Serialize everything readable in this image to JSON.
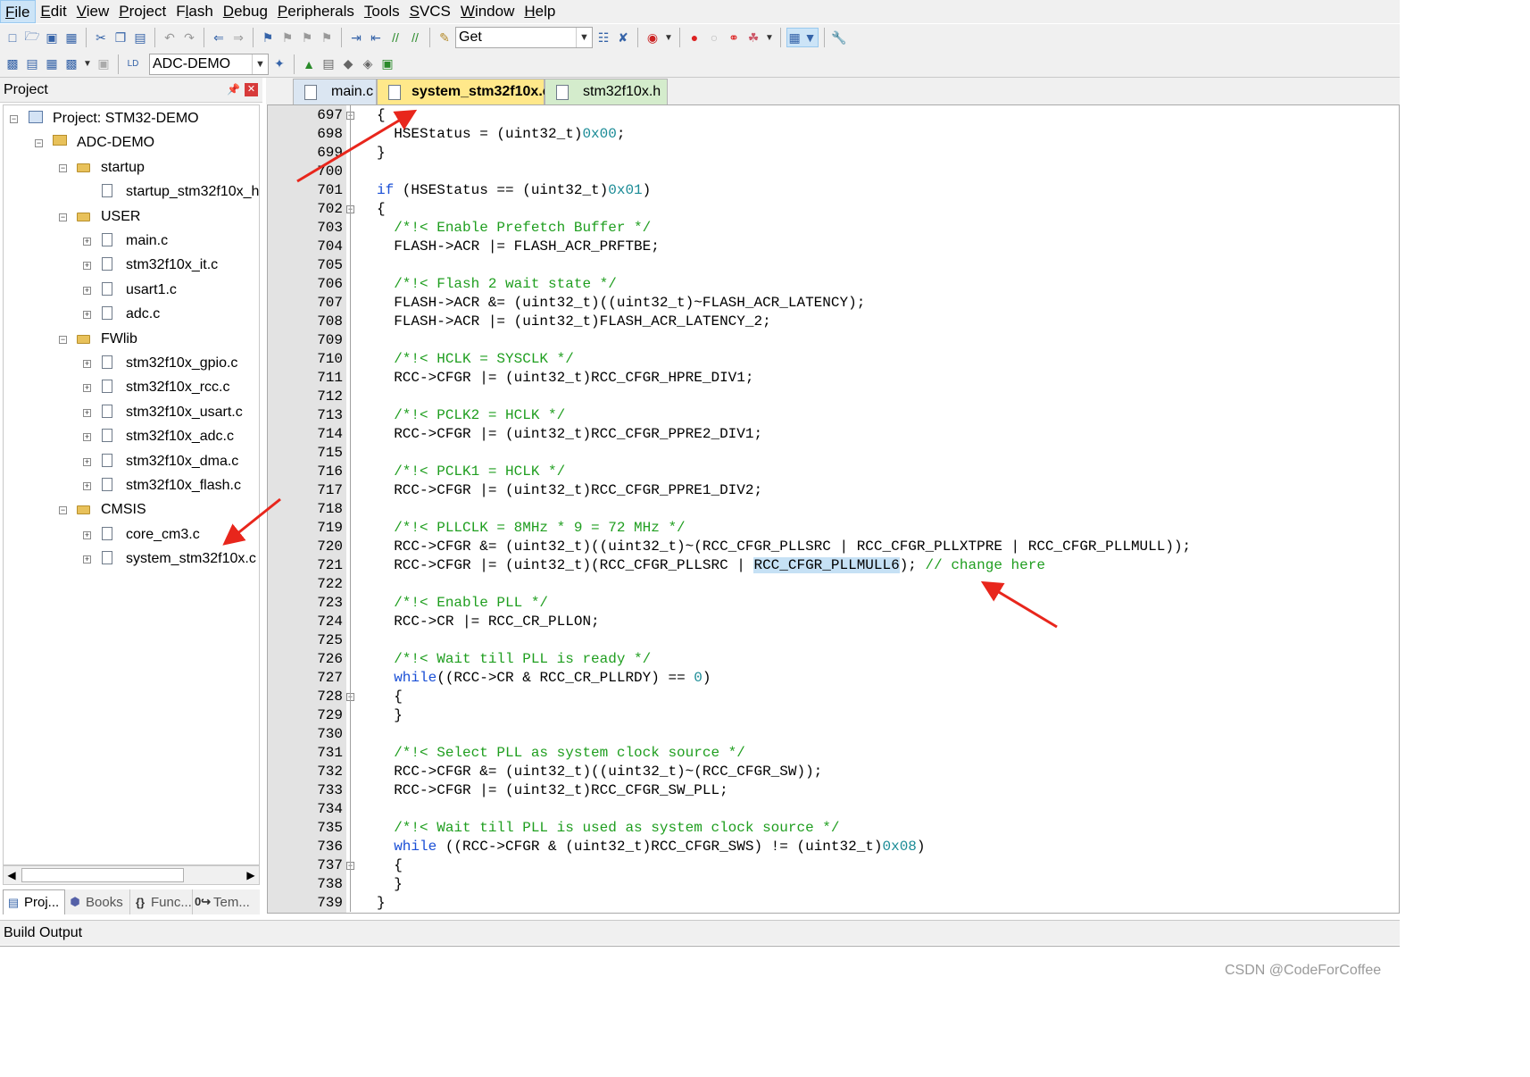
{
  "menu": [
    "File",
    "Edit",
    "View",
    "Project",
    "Flash",
    "Debug",
    "Peripherals",
    "Tools",
    "SVCS",
    "Window",
    "Help"
  ],
  "toolbar": {
    "find_value": "Get",
    "target_value": "ADC-DEMO"
  },
  "project_panel": {
    "title": "Project",
    "tree": [
      {
        "label": "Project: STM32-DEMO",
        "type": "project",
        "level": 0,
        "expander": "minus"
      },
      {
        "label": "ADC-DEMO",
        "type": "target",
        "level": 1,
        "expander": "minus"
      },
      {
        "label": "startup",
        "type": "folder",
        "level": 2,
        "expander": "minus"
      },
      {
        "label": "startup_stm32f10x_h",
        "type": "file",
        "level": 3,
        "expander": ""
      },
      {
        "label": "USER",
        "type": "folder",
        "level": 2,
        "expander": "minus"
      },
      {
        "label": "main.c",
        "type": "file",
        "level": 3,
        "expander": "plus"
      },
      {
        "label": "stm32f10x_it.c",
        "type": "file",
        "level": 3,
        "expander": "plus"
      },
      {
        "label": "usart1.c",
        "type": "file",
        "level": 3,
        "expander": "plus"
      },
      {
        "label": "adc.c",
        "type": "file",
        "level": 3,
        "expander": "plus"
      },
      {
        "label": "FWlib",
        "type": "folder",
        "level": 2,
        "expander": "minus"
      },
      {
        "label": "stm32f10x_gpio.c",
        "type": "file",
        "level": 3,
        "expander": "plus"
      },
      {
        "label": "stm32f10x_rcc.c",
        "type": "file",
        "level": 3,
        "expander": "plus"
      },
      {
        "label": "stm32f10x_usart.c",
        "type": "file",
        "level": 3,
        "expander": "plus"
      },
      {
        "label": "stm32f10x_adc.c",
        "type": "file",
        "level": 3,
        "expander": "plus"
      },
      {
        "label": "stm32f10x_dma.c",
        "type": "file",
        "level": 3,
        "expander": "plus"
      },
      {
        "label": "stm32f10x_flash.c",
        "type": "file",
        "level": 3,
        "expander": "plus"
      },
      {
        "label": "CMSIS",
        "type": "folder",
        "level": 2,
        "expander": "minus"
      },
      {
        "label": "core_cm3.c",
        "type": "file",
        "level": 3,
        "expander": "plus"
      },
      {
        "label": "system_stm32f10x.c",
        "type": "file",
        "level": 3,
        "expander": "plus"
      }
    ],
    "tabs": [
      "Proj...",
      "Books",
      "Func...",
      "Tem..."
    ]
  },
  "file_tabs": [
    {
      "label": "main.c",
      "active": false
    },
    {
      "label": "system_stm32f10x.c",
      "active": true
    },
    {
      "label": "stm32f10x.h",
      "active": false
    }
  ],
  "code": [
    {
      "n": "697",
      "fold": "minus",
      "t": [
        [
          "p",
          "{"
        ]
      ]
    },
    {
      "n": "698",
      "fold": "",
      "t": [
        [
          "p",
          "  HSEStatus = (uint32_t)"
        ],
        [
          "nm",
          "0x00"
        ],
        [
          "p",
          ";"
        ]
      ]
    },
    {
      "n": "699",
      "fold": "",
      "t": [
        [
          "p",
          "}"
        ]
      ]
    },
    {
      "n": "700",
      "fold": "",
      "t": []
    },
    {
      "n": "701",
      "fold": "",
      "t": [
        [
          "kw",
          "if"
        ],
        [
          "p",
          " (HSEStatus == (uint32_t)"
        ],
        [
          "nm",
          "0x01"
        ],
        [
          "p",
          ")"
        ]
      ]
    },
    {
      "n": "702",
      "fold": "minus",
      "t": [
        [
          "p",
          "{"
        ]
      ]
    },
    {
      "n": "703",
      "fold": "",
      "t": [
        [
          "cm",
          "  /*!< Enable Prefetch Buffer */"
        ]
      ]
    },
    {
      "n": "704",
      "fold": "",
      "t": [
        [
          "p",
          "  FLASH->ACR |= FLASH_ACR_PRFTBE;"
        ]
      ]
    },
    {
      "n": "705",
      "fold": "",
      "t": []
    },
    {
      "n": "706",
      "fold": "",
      "t": [
        [
          "cm",
          "  /*!< Flash 2 wait state */"
        ]
      ]
    },
    {
      "n": "707",
      "fold": "",
      "t": [
        [
          "p",
          "  FLASH->ACR &= (uint32_t)((uint32_t)~FLASH_ACR_LATENCY);"
        ]
      ]
    },
    {
      "n": "708",
      "fold": "",
      "t": [
        [
          "p",
          "  FLASH->ACR |= (uint32_t)FLASH_ACR_LATENCY_2;"
        ]
      ]
    },
    {
      "n": "709",
      "fold": "",
      "t": []
    },
    {
      "n": "710",
      "fold": "",
      "t": [
        [
          "cm",
          "  /*!< HCLK = SYSCLK */"
        ]
      ]
    },
    {
      "n": "711",
      "fold": "",
      "t": [
        [
          "p",
          "  RCC->CFGR |= (uint32_t)RCC_CFGR_HPRE_DIV1;"
        ]
      ]
    },
    {
      "n": "712",
      "fold": "",
      "t": []
    },
    {
      "n": "713",
      "fold": "",
      "t": [
        [
          "cm",
          "  /*!< PCLK2 = HCLK */"
        ]
      ]
    },
    {
      "n": "714",
      "fold": "",
      "t": [
        [
          "p",
          "  RCC->CFGR |= (uint32_t)RCC_CFGR_PPRE2_DIV1;"
        ]
      ]
    },
    {
      "n": "715",
      "fold": "",
      "t": []
    },
    {
      "n": "716",
      "fold": "",
      "t": [
        [
          "cm",
          "  /*!< PCLK1 = HCLK */"
        ]
      ]
    },
    {
      "n": "717",
      "fold": "",
      "t": [
        [
          "p",
          "  RCC->CFGR |= (uint32_t)RCC_CFGR_PPRE1_DIV2;"
        ]
      ]
    },
    {
      "n": "718",
      "fold": "",
      "t": []
    },
    {
      "n": "719",
      "fold": "",
      "t": [
        [
          "cm",
          "  /*!< PLLCLK = 8MHz * 9 = 72 MHz */"
        ]
      ]
    },
    {
      "n": "720",
      "fold": "",
      "t": [
        [
          "p",
          "  RCC->CFGR &= (uint32_t)((uint32_t)~(RCC_CFGR_PLLSRC | RCC_CFGR_PLLXTPRE | RCC_CFGR_PLLMULL));"
        ]
      ]
    },
    {
      "n": "721",
      "fold": "",
      "t": [
        [
          "p",
          "  RCC->CFGR |= (uint32_t)(RCC_CFGR_PLLSRC | "
        ],
        [
          "hl",
          "RCC_CFGR_PLLMULL6"
        ],
        [
          "p",
          "); "
        ],
        [
          "cm",
          "// change here"
        ]
      ]
    },
    {
      "n": "722",
      "fold": "",
      "t": []
    },
    {
      "n": "723",
      "fold": "",
      "t": [
        [
          "cm",
          "  /*!< Enable PLL */"
        ]
      ]
    },
    {
      "n": "724",
      "fold": "",
      "t": [
        [
          "p",
          "  RCC->CR |= RCC_CR_PLLON;"
        ]
      ]
    },
    {
      "n": "725",
      "fold": "",
      "t": []
    },
    {
      "n": "726",
      "fold": "",
      "t": [
        [
          "cm",
          "  /*!< Wait till PLL is ready */"
        ]
      ]
    },
    {
      "n": "727",
      "fold": "",
      "t": [
        [
          "kw",
          "  while"
        ],
        [
          "p",
          "((RCC->CR & RCC_CR_PLLRDY) == "
        ],
        [
          "nm",
          "0"
        ],
        [
          "p",
          ")"
        ]
      ]
    },
    {
      "n": "728",
      "fold": "minus",
      "t": [
        [
          "p",
          "  {"
        ]
      ]
    },
    {
      "n": "729",
      "fold": "",
      "t": [
        [
          "p",
          "  }"
        ]
      ]
    },
    {
      "n": "730",
      "fold": "",
      "t": []
    },
    {
      "n": "731",
      "fold": "",
      "t": [
        [
          "cm",
          "  /*!< Select PLL as system clock source */"
        ]
      ]
    },
    {
      "n": "732",
      "fold": "",
      "t": [
        [
          "p",
          "  RCC->CFGR &= (uint32_t)((uint32_t)~(RCC_CFGR_SW));"
        ]
      ]
    },
    {
      "n": "733",
      "fold": "",
      "t": [
        [
          "p",
          "  RCC->CFGR |= (uint32_t)RCC_CFGR_SW_PLL;"
        ]
      ]
    },
    {
      "n": "734",
      "fold": "",
      "t": []
    },
    {
      "n": "735",
      "fold": "",
      "t": [
        [
          "cm",
          "  /*!< Wait till PLL is used as system clock source */"
        ]
      ]
    },
    {
      "n": "736",
      "fold": "",
      "t": [
        [
          "kw",
          "  while"
        ],
        [
          "p",
          " ((RCC->CFGR & (uint32_t)RCC_CFGR_SWS) != (uint32_t)"
        ],
        [
          "nm",
          "0x08"
        ],
        [
          "p",
          ")"
        ]
      ]
    },
    {
      "n": "737",
      "fold": "minus",
      "t": [
        [
          "p",
          "  {"
        ]
      ]
    },
    {
      "n": "738",
      "fold": "",
      "t": [
        [
          "p",
          "  }"
        ]
      ]
    },
    {
      "n": "739",
      "fold": "",
      "t": [
        [
          "p",
          "}"
        ]
      ]
    }
  ],
  "build_output": {
    "title": "Build Output"
  },
  "watermark": "CSDN @CodeForCoffee",
  "colors": {
    "comment": "#1f9e1f",
    "keyword": "#1a4fd6",
    "number": "#1a8b96",
    "arrow": "#e8261c",
    "active_tab": "#ffe88a"
  }
}
